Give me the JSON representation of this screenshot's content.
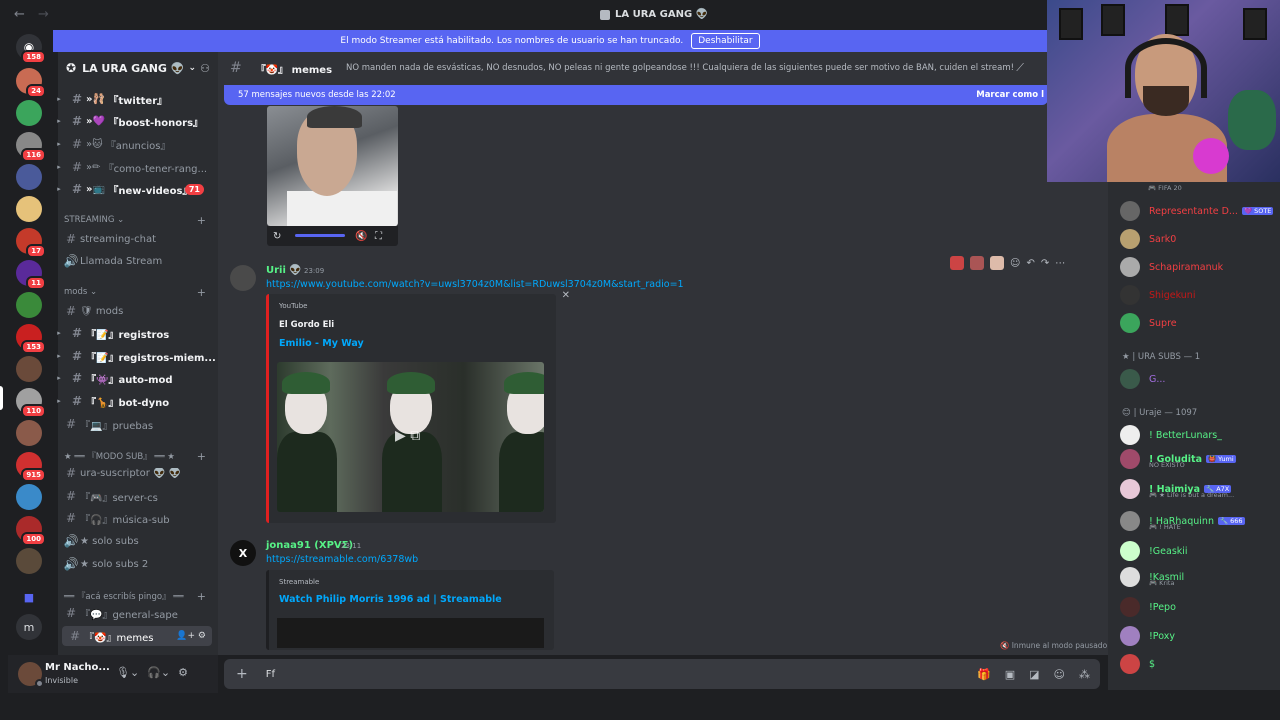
{
  "window": {
    "title": "LA URA GANG 👽",
    "back": "←",
    "forward": "→"
  },
  "streamer_bar": {
    "text": "El modo Streamer está habilitado. Los nombres de usuario se han truncado.",
    "button": "Deshabilitar"
  },
  "server_badges": [
    "158",
    "24",
    "116",
    "17",
    "11",
    "153",
    "110",
    "915",
    "100"
  ],
  "server_letter": "m",
  "guild": {
    "name": "LA URA GANG 👽",
    "chevron": "⌄"
  },
  "channels": [
    {
      "icon": "»🩰",
      "name": "『twitter』"
    },
    {
      "icon": "»💜",
      "name": "『boost-honors』"
    },
    {
      "icon": "»🐱",
      "name": "『anuncios』"
    },
    {
      "icon": "»✏",
      "name": "『como-tener-rang..."
    },
    {
      "icon": "»📺",
      "name": "『new-videos』",
      "badge": "71"
    }
  ],
  "categories": {
    "streaming": "STREAMING ⌄",
    "mods": "mods ⌄",
    "modo_sub": "★ ══ 『MODO SUB』 ══ ★",
    "aca": "══ 『acá escribís pingo』 ══"
  },
  "streaming_channels": [
    "streaming-chat",
    "Llamada Stream"
  ],
  "mod_channels": [
    "🛡 mods",
    "『📝』registros",
    "『📝』registros-miem...",
    "『👾』auto-mod",
    "『🦒』bot-dyno",
    "『💻』pruebas"
  ],
  "sub_channels": [
    "ura-suscriptor 👽 👽",
    "『🎮』server-cs",
    "『🎧』música-sub",
    "★ solo subs",
    "★ solo subs 2"
  ],
  "aca_channels": [
    "『💬』general-sape",
    "『🤡』memes"
  ],
  "user": {
    "name": "Mr Nacho...",
    "status": "Invisible"
  },
  "chat": {
    "channel": "『🤡』 memes",
    "topic": "NO manden nada de esvásticas, NO desnudos, NO peleas ni gente golpeandose !!! Cualquiera de las siguientes puede ser motivo de BAN, cuiden el stream!",
    "new_messages": "57 mensajes nuevos desde las 22:02",
    "mark_read": "Marcar como l",
    "messages": [
      {
        "user": "Urii 👽",
        "time": "23:09",
        "link": "https://www.youtube.com/watch?v=uwsl3704z0M&list=RDuwsl3704z0M&start_radio=1",
        "embed": {
          "provider": "YouTube",
          "author": "El Gordo Eli",
          "title": "Emilio - My Way",
          "close": "✕"
        }
      },
      {
        "user": "jonaa91 (XPVΣ)",
        "time": "23:11",
        "link": "https://streamable.com/6378wb",
        "embed": {
          "provider": "Streamable",
          "title": "Watch Philip Morris 1996 ad | Streamable"
        }
      }
    ],
    "immune": "🔇 Inmune al modo pausado",
    "input_text": "Ff"
  },
  "members": {
    "top": [
      {
        "name": "Representante D...",
        "tag": "💜 SOTE",
        "color": "#f23f43",
        "sub": "🎮 FIFA 20"
      },
      {
        "name": "Sark0",
        "color": "#f23f43"
      },
      {
        "name": "Schapiramanuk",
        "color": "#f23f43"
      },
      {
        "name": "Shigekuni",
        "color": "#c41818"
      },
      {
        "name": "Supre",
        "color": "#f23f43"
      }
    ],
    "group1": "★ | URA SUBS — 1",
    "group1_members": [
      {
        "name": "G...",
        "color": "#a36ee0"
      }
    ],
    "group2": "😊 | Uraje — 1097",
    "group2_members": [
      {
        "name": "! BetterLunars_",
        "color": "#57f287"
      },
      {
        "name": "! Goludita",
        "tag": "👹 Yumi",
        "color": "#57f287",
        "sub": "NO EXISTO"
      },
      {
        "name": "! Haimiya",
        "tag": "🔧 A7X",
        "color": "#57f287",
        "sub": "🎮 ★ Life is but a dream..."
      },
      {
        "name": "! HaRhaquinn",
        "tag": "🔧 666",
        "color": "#57f287",
        "sub": "🎮 ! HATE"
      },
      {
        "name": "!Geaskii",
        "color": "#57f287"
      },
      {
        "name": "!Kasmil",
        "color": "#57f287",
        "sub": "🎮 Krita"
      },
      {
        "name": "!Pepo",
        "color": "#57f287"
      },
      {
        "name": "!Poxy",
        "color": "#57f287"
      },
      {
        "name": "$",
        "color": "#57f287"
      }
    ]
  },
  "colors": {
    "blurple": "#5865f2",
    "red": "#f23f43",
    "green": "#57f287",
    "link": "#00a8fc"
  },
  "icons": {
    "hash": "#",
    "plus": "+",
    "gear": "⚙",
    "mic": "🎙",
    "headset": "🎧"
  }
}
